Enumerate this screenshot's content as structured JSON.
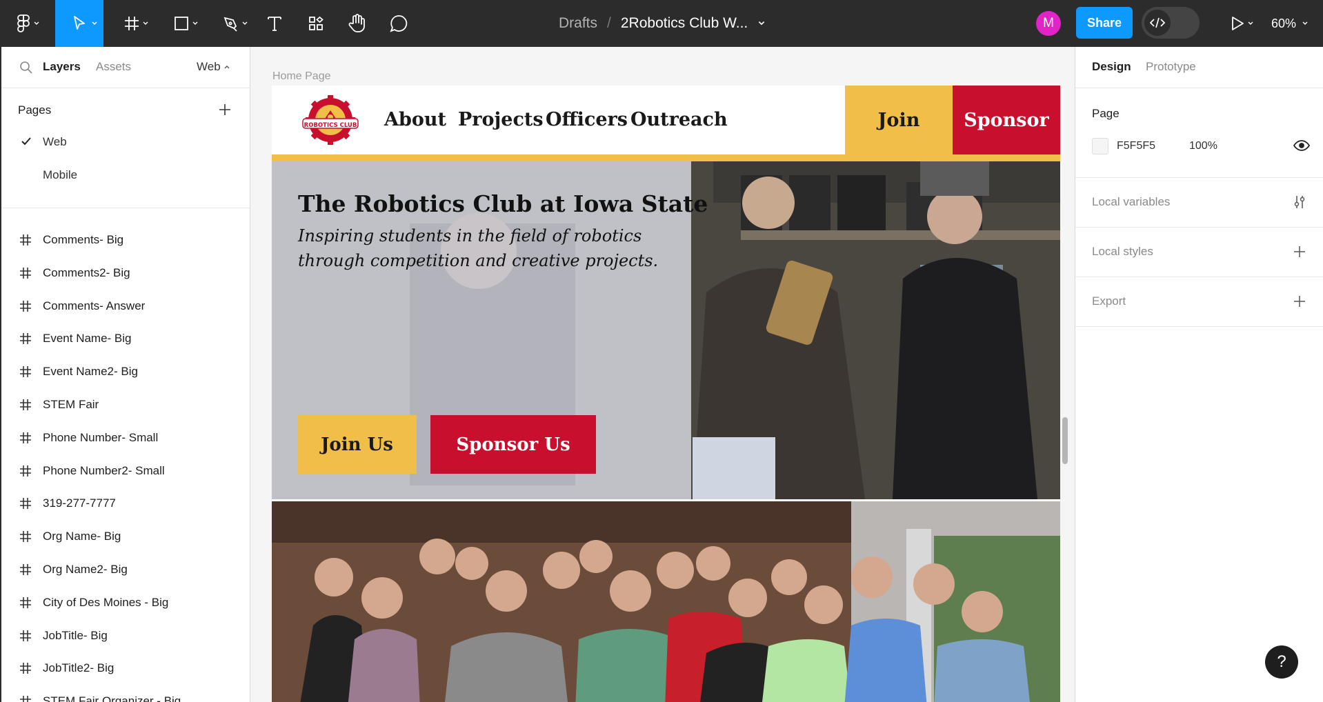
{
  "toolbar": {
    "breadcrumb_drafts": "Drafts",
    "breadcrumb_sep": "/",
    "file_name": "2Robotics Club W...",
    "avatar_initial": "M",
    "share_label": "Share",
    "zoom": "60%",
    "tools": [
      "main-menu",
      "move",
      "frame",
      "shape",
      "pen",
      "text",
      "resources",
      "hand",
      "comment"
    ],
    "colors": {
      "bg": "#2c2c2c",
      "accent": "#0d99ff",
      "avatar": "#e024c5"
    }
  },
  "left_panel": {
    "tab_layers": "Layers",
    "tab_assets": "Assets",
    "page_switch": "Web",
    "pages_title": "Pages",
    "pages": [
      {
        "label": "Web",
        "selected": true
      },
      {
        "label": "Mobile",
        "selected": false
      }
    ],
    "layers": [
      "Comments- Big",
      "Comments2- Big",
      "Comments- Answer",
      "Event Name- Big",
      "Event Name2- Big",
      "STEM Fair",
      "Phone Number- Small",
      "Phone Number2- Small",
      "319-277-7777",
      "Org Name- Big",
      "Org Name2- Big",
      "City of Des Moines - Big",
      "JobTitle- Big",
      "JobTitle2- Big",
      "STEM Fair Organizer - Big"
    ]
  },
  "right_panel": {
    "tab_design": "Design",
    "tab_prototype": "Prototype",
    "page_title": "Page",
    "page_color": "F5F5F5",
    "page_opacity": "100%",
    "local_variables": "Local variables",
    "local_styles": "Local styles",
    "export": "Export"
  },
  "canvas": {
    "frame_label": "Home Page",
    "site": {
      "logo_text": "ROBOTICS CLUB",
      "nav": [
        "About",
        "Projects",
        "Officers",
        "Outreach"
      ],
      "nav_join": "Join",
      "nav_sponsor": "Sponsor",
      "hero_title": "The Robotics Club at Iowa State",
      "hero_subtitle": "Inspiring students in the field of robotics through competition and creative projects.",
      "btn_join": "Join Us",
      "btn_sponsor": "Sponsor Us",
      "colors": {
        "gold": "#f1be48",
        "red": "#c8102e"
      }
    }
  },
  "help_label": "?"
}
